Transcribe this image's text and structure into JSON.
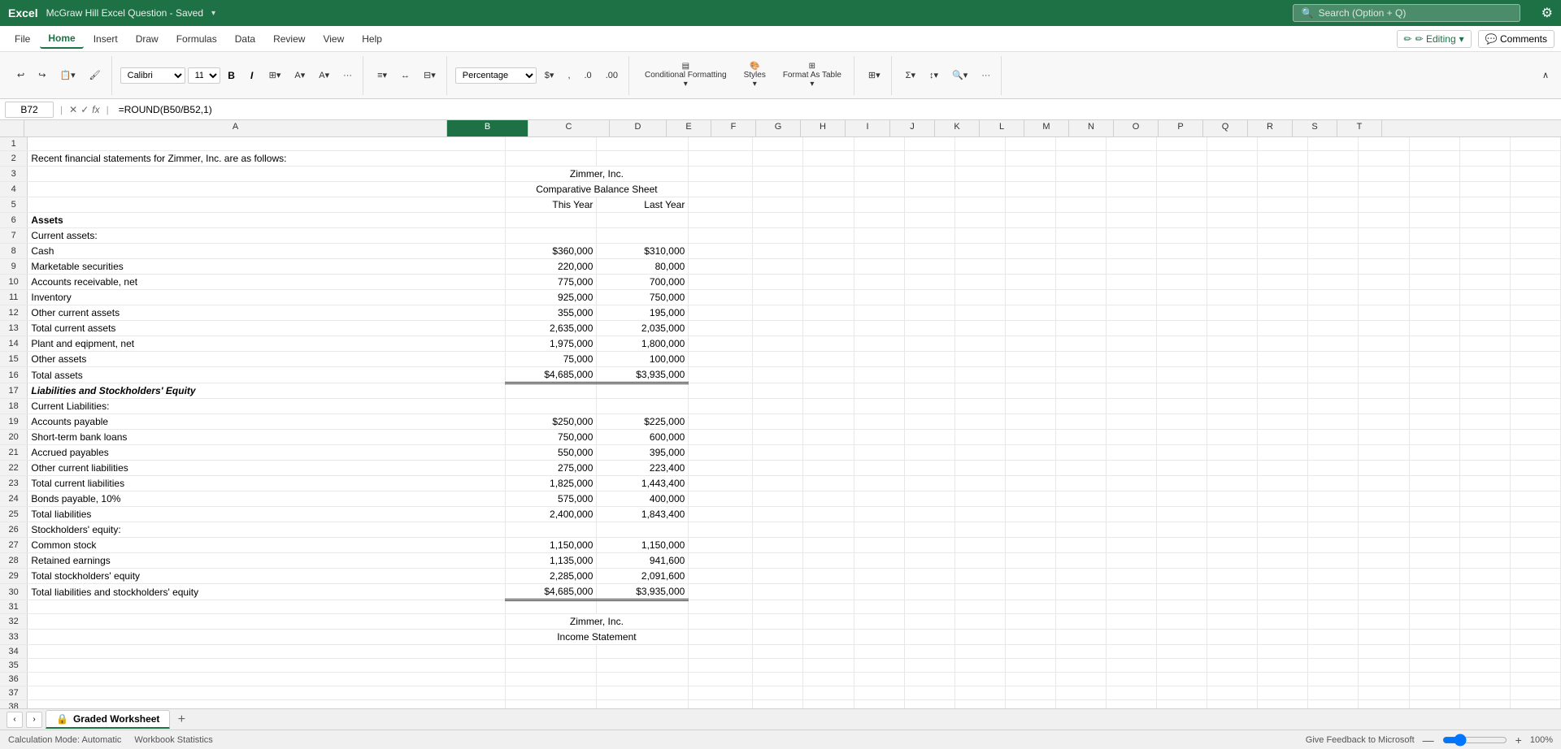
{
  "titleBar": {
    "appName": "Excel",
    "docTitle": "McGraw Hill Excel Question - Saved",
    "searchPlaceholder": "Search (Option + Q)",
    "settingsIcon": "⚙"
  },
  "menuBar": {
    "items": [
      "File",
      "Home",
      "Insert",
      "Draw",
      "Formulas",
      "Data",
      "Review",
      "View",
      "Help"
    ],
    "activeItem": "Home",
    "editingLabel": "✏ Editing",
    "commentsLabel": "Comments"
  },
  "ribbon": {
    "undoLabel": "↩",
    "fontName": "Calibri",
    "fontSize": "11",
    "boldLabel": "B",
    "italicLabel": "I",
    "numberFormat": "Percentage",
    "conditionalFormatting": "Conditional Formatting",
    "stylesLabel": "Styles",
    "formatAsTable": "Format As Table",
    "sumLabel": "Σ"
  },
  "formulaBar": {
    "cellRef": "B72",
    "formula": "=ROUND(B50/B52,1)"
  },
  "columns": {
    "headers": [
      "A",
      "B",
      "C",
      "D",
      "E",
      "F",
      "G",
      "H",
      "I",
      "J",
      "K",
      "L",
      "M",
      "N",
      "O",
      "P",
      "Q",
      "R",
      "S",
      "T"
    ],
    "selectedCol": "B",
    "widths": [
      520,
      100,
      100,
      70,
      55,
      55,
      55,
      55,
      55,
      55,
      55,
      55,
      55,
      55,
      55,
      55,
      55,
      55,
      55,
      55
    ]
  },
  "rows": [
    {
      "num": 1,
      "A": "",
      "B": "",
      "C": ""
    },
    {
      "num": 2,
      "A": "Recent financial statements for Zimmer, Inc. are as follows:",
      "B": "",
      "C": ""
    },
    {
      "num": 3,
      "A": "",
      "B": "Zimmer, Inc.",
      "C": "",
      "Bcenter": true
    },
    {
      "num": 4,
      "A": "",
      "B": "Comparative Balance Sheet",
      "C": "",
      "Bcenter": true
    },
    {
      "num": 5,
      "A": "",
      "B": "This Year",
      "C": "Last Year"
    },
    {
      "num": 6,
      "A": "Assets",
      "B": "",
      "C": "",
      "Abold": true
    },
    {
      "num": 7,
      "A": "Current assets:",
      "B": "",
      "C": ""
    },
    {
      "num": 8,
      "A": "  Cash",
      "B": "$360,000",
      "C": "$310,000"
    },
    {
      "num": 9,
      "A": "  Marketable securities",
      "B": "220,000",
      "C": "80,000"
    },
    {
      "num": 10,
      "A": "  Accounts receivable, net",
      "B": "775,000",
      "C": "700,000"
    },
    {
      "num": 11,
      "A": "  Inventory",
      "B": "925,000",
      "C": "750,000"
    },
    {
      "num": 12,
      "A": "  Other current assets",
      "B": "355,000",
      "C": "195,000"
    },
    {
      "num": 13,
      "A": "Total current assets",
      "B": "2,635,000",
      "C": "2,035,000"
    },
    {
      "num": 14,
      "A": "Plant and eqipment, net",
      "B": "1,975,000",
      "C": "1,800,000"
    },
    {
      "num": 15,
      "A": "Other assets",
      "B": "75,000",
      "C": "100,000"
    },
    {
      "num": 16,
      "A": "Total assets",
      "B": "$4,685,000",
      "C": "$3,935,000",
      "border": true
    },
    {
      "num": 17,
      "A": "Liabilities and Stockholders' Equity",
      "B": "",
      "C": "",
      "Abold": true,
      "Aitalic": true
    },
    {
      "num": 18,
      "A": "Current Liabilities:",
      "B": "",
      "C": ""
    },
    {
      "num": 19,
      "A": "  Accounts payable",
      "B": "$250,000",
      "C": "$225,000"
    },
    {
      "num": 20,
      "A": "  Short-term bank loans",
      "B": "750,000",
      "C": "600,000"
    },
    {
      "num": 21,
      "A": "  Accrued payables",
      "B": "550,000",
      "C": "395,000"
    },
    {
      "num": 22,
      "A": "  Other current liabilities",
      "B": "275,000",
      "C": "223,400"
    },
    {
      "num": 23,
      "A": "Total current liabilities",
      "B": "1,825,000",
      "C": "1,443,400"
    },
    {
      "num": 24,
      "A": "Bonds payable, 10%",
      "B": "575,000",
      "C": "400,000"
    },
    {
      "num": 25,
      "A": "Total liabilities",
      "B": "2,400,000",
      "C": "1,843,400"
    },
    {
      "num": 26,
      "A": "Stockholders' equity:",
      "B": "",
      "C": ""
    },
    {
      "num": 27,
      "A": "  Common stock",
      "B": "1,150,000",
      "C": "1,150,000"
    },
    {
      "num": 28,
      "A": "  Retained earnings",
      "B": "1,135,000",
      "C": "941,600"
    },
    {
      "num": 29,
      "A": "Total stockholders' equity",
      "B": "2,285,000",
      "C": "2,091,600"
    },
    {
      "num": 30,
      "A": "Total liabilities and stockholders' equity",
      "B": "$4,685,000",
      "C": "$3,935,000",
      "border": true
    },
    {
      "num": 31,
      "A": "",
      "B": "",
      "C": ""
    },
    {
      "num": 32,
      "A": "",
      "B": "Zimmer, Inc.",
      "C": "",
      "Bcenter": true
    },
    {
      "num": 33,
      "A": "",
      "B": "Income Statement",
      "C": "",
      "Bcenter": true,
      "partial": true
    }
  ],
  "sheetTab": {
    "icon": "🔒",
    "label": "Graded Worksheet",
    "addIcon": "+"
  },
  "statusBar": {
    "calcMode": "Calculation Mode: Automatic",
    "wbStats": "Workbook Statistics",
    "feedback": "Give Feedback to Microsoft",
    "zoom": "100%",
    "zoomMinus": "—",
    "zoomPlus": "+"
  }
}
